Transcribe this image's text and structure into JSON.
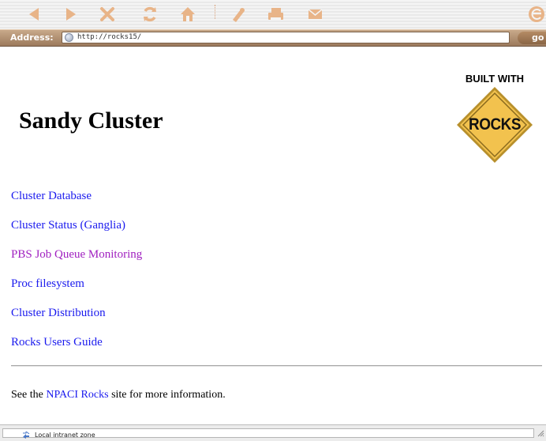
{
  "toolbar": {
    "buttons": [
      {
        "name": "back",
        "icon": "back-arrow-icon"
      },
      {
        "name": "forward",
        "icon": "forward-arrow-icon"
      },
      {
        "name": "stop",
        "icon": "stop-x-icon"
      },
      {
        "name": "refresh",
        "icon": "refresh-icon"
      },
      {
        "name": "home",
        "icon": "home-icon"
      },
      {
        "name": "autofill",
        "icon": "autofill-pen-icon"
      },
      {
        "name": "print",
        "icon": "printer-icon"
      },
      {
        "name": "mail",
        "icon": "mail-envelope-icon"
      },
      {
        "name": "browser-logo",
        "icon": "browser-e-logo-icon"
      }
    ],
    "icon_color": "#e8b488"
  },
  "address_bar": {
    "label": "Address:",
    "url": "http://rocks15/",
    "go_label": "go"
  },
  "page": {
    "title": "Sandy Cluster",
    "logo": {
      "caption": "BUILT WITH",
      "sign_text": "ROCKS",
      "sign_color": "#f2c24e"
    },
    "links": [
      {
        "label": "Cluster Database",
        "visited": false
      },
      {
        "label": "Cluster Status (Ganglia)",
        "visited": false
      },
      {
        "label": "PBS Job Queue Monitoring",
        "visited": true
      },
      {
        "label": "Proc filesystem",
        "visited": false
      },
      {
        "label": "Cluster Distribution",
        "visited": false
      },
      {
        "label": "Rocks Users Guide",
        "visited": false
      }
    ],
    "footer": {
      "prefix": "See the ",
      "link": "NPACI Rocks",
      "suffix": " site for more information."
    },
    "colors": {
      "link": "#1a1aee",
      "visited_link": "#a020c0"
    }
  },
  "status_bar": {
    "zone_text": "Local intranet zone",
    "zone_icon": "local-intranet-icon"
  }
}
